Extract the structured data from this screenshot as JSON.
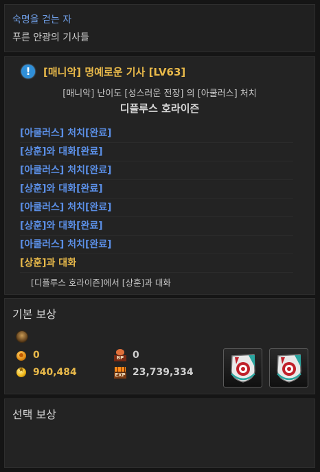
{
  "header": {
    "chapter_title": "숙명을 걷는 자",
    "subtitle": "푸른 안광의 기사들"
  },
  "quest": {
    "icon": "exclamation-icon",
    "title": "[매니악] 명예로운 기사 [LV63]",
    "description": "[매니악] 난이도 [성스러운 전장] 의 [아쿨러스] 처치",
    "target": "디플루스 호라이즌",
    "objectives": [
      {
        "text": "[아쿨러스] 처치[완료]",
        "status": "complete"
      },
      {
        "text": "[상훈]와 대화[완료]",
        "status": "complete"
      },
      {
        "text": "[아쿨러스] 처치[완료]",
        "status": "complete"
      },
      {
        "text": "[상훈]와 대화[완료]",
        "status": "complete"
      },
      {
        "text": "[아쿨러스] 처치[완료]",
        "status": "complete"
      },
      {
        "text": "[상훈]와 대화[완료]",
        "status": "complete"
      },
      {
        "text": "[아쿨러스] 처치[완료]",
        "status": "complete"
      },
      {
        "text": "[상훈]과 대화",
        "status": "current"
      }
    ],
    "current_objective_detail": "[디플루스 호라이즌]에서 [상훈]과 대화"
  },
  "basic_reward": {
    "title": "기본 보상",
    "grade_icon": "bronze-grade-icon",
    "fame": "0",
    "gold": "940,484",
    "bp": "0",
    "exp": "23,739,334",
    "bp_label": "BP",
    "exp_label": "EXP",
    "items": [
      {
        "icon": "shield-emblem-icon"
      },
      {
        "icon": "shield-emblem-icon"
      }
    ]
  },
  "select_reward": {
    "title": "선택 보상"
  },
  "colors": {
    "chapter": "#6f9ee6",
    "quest_title": "#e8b94a",
    "objective_complete": "#5b8fe6",
    "objective_current": "#e8b94a",
    "gold_text": "#e8b94a"
  }
}
